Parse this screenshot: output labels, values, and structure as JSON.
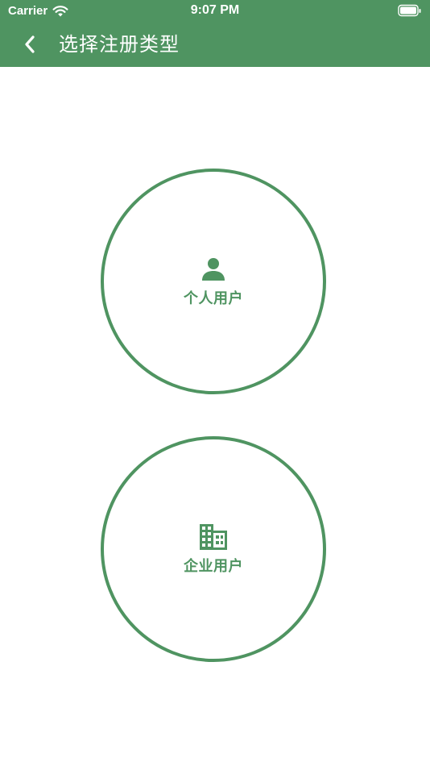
{
  "status_bar": {
    "carrier": "Carrier",
    "time": "9:07 PM",
    "wifi_icon": "wifi-icon",
    "battery_icon": "battery-icon"
  },
  "nav": {
    "title": "选择注册类型",
    "back_icon": "chevron-left-icon"
  },
  "options": [
    {
      "label": "个人用户",
      "icon": "person-icon"
    },
    {
      "label": "企业用户",
      "icon": "building-icon"
    }
  ],
  "colors": {
    "accent": "#4f9461",
    "background": "#ffffff",
    "header_text": "#ffffff"
  }
}
